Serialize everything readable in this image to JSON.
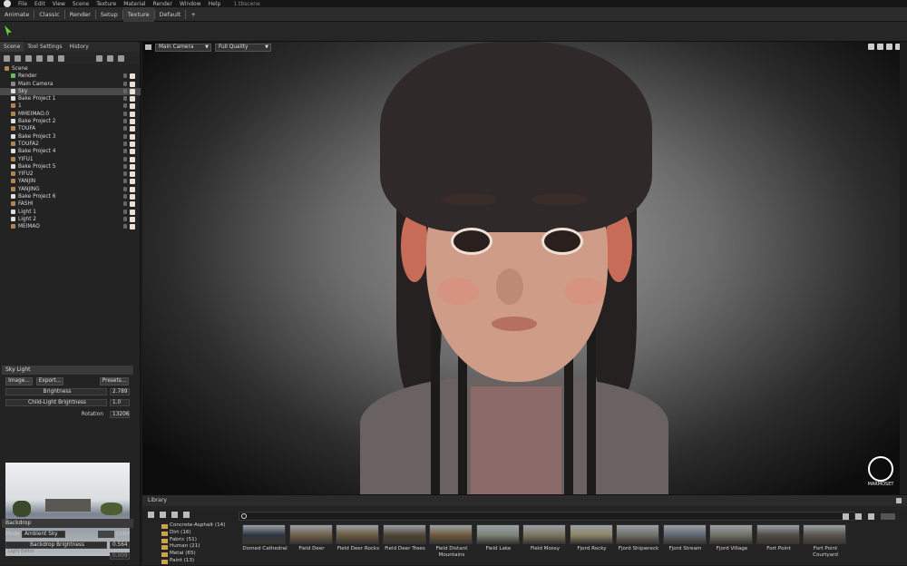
{
  "menubar": {
    "items": [
      "File",
      "Edit",
      "View",
      "Scene",
      "Texture",
      "Material",
      "Render",
      "Window",
      "Help"
    ],
    "file": "1.tbscene"
  },
  "tabs": [
    "Animate",
    "Classic",
    "Render",
    "Setup",
    "Texture",
    "Default",
    "+"
  ],
  "active_tab": "Texture",
  "panel_tabs": [
    "Scene",
    "Tool Settings",
    "History"
  ],
  "scene_tree": [
    {
      "label": "Scene",
      "icon": "scene-icon"
    },
    {
      "label": "Render",
      "icon": "render-icon"
    },
    {
      "label": "Main Camera",
      "icon": "camera-icon"
    },
    {
      "label": "Sky",
      "icon": "sky-icon",
      "selected": true
    },
    {
      "label": "Bake Project 1",
      "icon": "bake-icon"
    },
    {
      "label": "1",
      "icon": "mesh-icon"
    },
    {
      "label": "MMEIMAO.0",
      "icon": "mesh-icon"
    },
    {
      "label": "Bake Project 2",
      "icon": "bake-icon"
    },
    {
      "label": "TOUFA",
      "icon": "mesh-icon"
    },
    {
      "label": "Bake Project 3",
      "icon": "bake-icon"
    },
    {
      "label": "TOUFA2",
      "icon": "mesh-icon"
    },
    {
      "label": "Bake Project 4",
      "icon": "bake-icon"
    },
    {
      "label": "YIFU1",
      "icon": "mesh-icon"
    },
    {
      "label": "Bake Project 5",
      "icon": "bake-icon"
    },
    {
      "label": "YIFU2",
      "icon": "mesh-icon"
    },
    {
      "label": "YANJIN",
      "icon": "mesh-icon"
    },
    {
      "label": "YANJING",
      "icon": "mesh-icon"
    },
    {
      "label": "Bake Project 6",
      "icon": "bake-icon"
    },
    {
      "label": "FASHI",
      "icon": "mesh-icon"
    },
    {
      "label": "Light 1",
      "icon": "light-icon"
    },
    {
      "label": "Light 2",
      "icon": "light-icon"
    },
    {
      "label": "MEIMAO",
      "icon": "mesh-icon"
    }
  ],
  "sky_light": {
    "section": "Sky Light",
    "image_btn": "Image...",
    "export_btn": "Export...",
    "presets_btn": "Presets...",
    "brightness_label": "Brightness",
    "brightness": "2.789",
    "child_label": "Child-Light Brightness",
    "child": "1.0",
    "rotation_label": "Rotation",
    "rotation": "13206",
    "light_editor": "Light Editor"
  },
  "backdrop": {
    "section": "Backdrop",
    "mode_label": "Mode",
    "mode": "Ambient Sky",
    "color_label": "Color",
    "brightness_label": "Backdrop Brightness",
    "brightness": "0.564",
    "extra": "0.009"
  },
  "viewport": {
    "camera": "Main Camera",
    "quality": "Full Quality",
    "watermark": "MARMOSET"
  },
  "library": {
    "tab": "Library",
    "categories": [
      "Concrete-Asphalt (14)",
      "Dirt (16)",
      "Fabric (51)",
      "Human (21)",
      "Metal (65)",
      "Paint (13)"
    ],
    "thumbnails": [
      "Domed Cathedral",
      "Field Deer",
      "Field Deer Rocks",
      "Field Deer Trees",
      "Field Distant Mountains",
      "Field Lake",
      "Field Mossy",
      "Fjord Rocky",
      "Fjord Shipwreck",
      "Fjord Stream",
      "Fjord Village",
      "Fort Point",
      "Fort Point Courtyard"
    ]
  },
  "colors": {
    "accent": "#6ccd3a",
    "selection": "#4a4a4a",
    "folder": "#c9a24a"
  }
}
